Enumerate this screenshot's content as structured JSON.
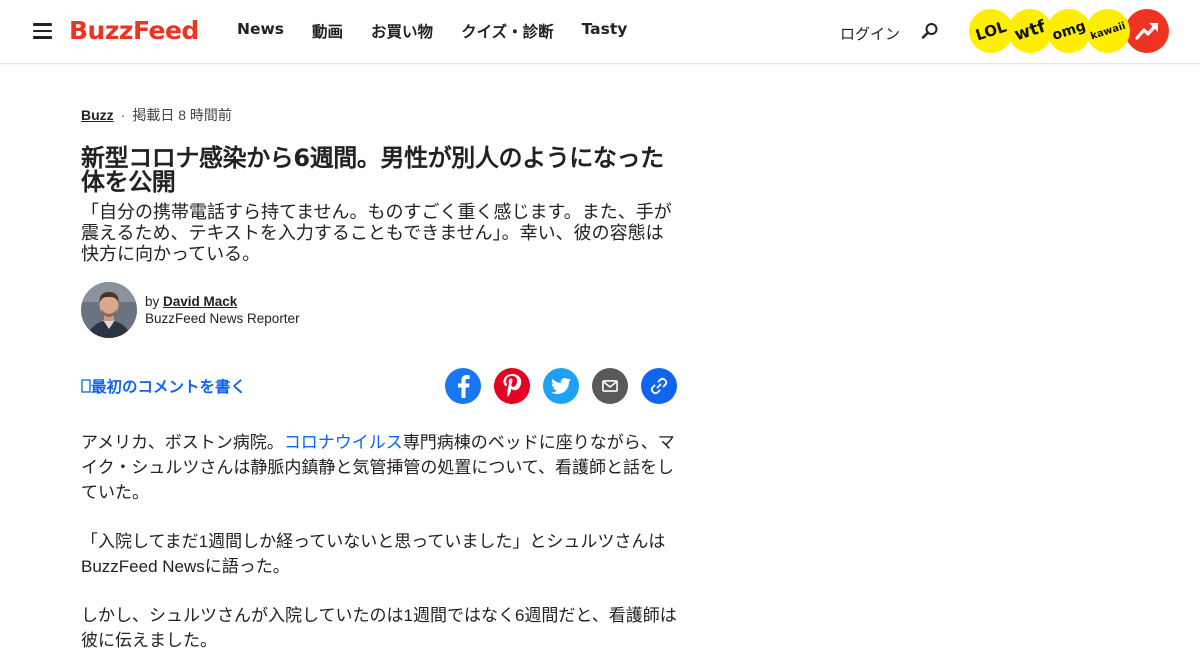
{
  "header": {
    "logo": "BuzzFeed",
    "nav": [
      "News",
      "動画",
      "お買い物",
      "クイズ・診断",
      "Tasty"
    ],
    "login": "ログイン",
    "badges": [
      {
        "label": "LOL",
        "color": "#ffee00"
      },
      {
        "label": "wtf",
        "color": "#ffee00"
      },
      {
        "label": "omg",
        "color": "#ffee00"
      },
      {
        "label": "kawaii",
        "color": "#ffee00"
      },
      {
        "label": "trending",
        "color": "#ee3322"
      }
    ]
  },
  "article": {
    "category": "Buzz",
    "separator": "·",
    "posted": "掲載日 8 時間前",
    "title": "新型コロナ感染から6週間。男性が別人のようになった体を公開",
    "dek": "「自分の携帯電話すら持てません。ものすごく重く感じます。また、手が震えるため、テキストを入力することもできません」。幸い、彼の容態は快方に向かっている。",
    "byline_prefix": "by",
    "author": "David Mack",
    "author_role": "BuzzFeed News Reporter",
    "comment_link": "最初のコメントを書く",
    "share": [
      {
        "name": "facebook",
        "color": "#1877f2"
      },
      {
        "name": "pinterest",
        "color": "#e60023"
      },
      {
        "name": "twitter",
        "color": "#1da1f2"
      },
      {
        "name": "email",
        "color": "#595959"
      },
      {
        "name": "copy-link",
        "color": "#0f65ef"
      }
    ],
    "paragraphs": [
      {
        "before": "アメリカ、ボストン病院。",
        "link": "コロナウイルス",
        "after": "専門病棟のベッドに座りながら、マイク・シュルツさんは静脈内鎮静と気管挿管の処置について、看護師と話をしていた。"
      },
      {
        "text": "「入院してまだ1週間しか経っていないと思っていました」とシュルツさんはBuzzFeed Newsに語った。"
      },
      {
        "text": "しかし、シュルツさんが入院していたのは1週間ではなく6週間だと、看護師は彼に伝えました。"
      }
    ]
  },
  "colors": {
    "brand": "#ee3322",
    "link": "#0f65ef"
  }
}
